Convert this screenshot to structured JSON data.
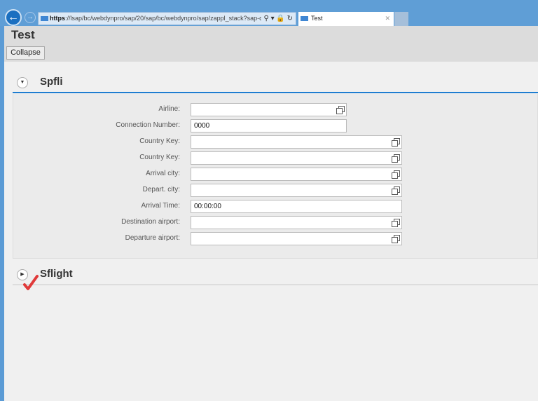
{
  "browser": {
    "url_scheme": "https",
    "url_rest": "://lsap/bc/webdynpro/sap/20/sap/bc/webdynpro/sap/zappl_stack?sap-client=",
    "tab_title": "Test",
    "accent": "#5f9ed6"
  },
  "header": {
    "title": "Test",
    "collapse_label": "Collapse"
  },
  "panels": [
    {
      "title": "Spfli",
      "expanded": true,
      "fields": [
        {
          "label": "Airline:",
          "value": "",
          "value_help": true
        },
        {
          "label": "Connection Number:",
          "value": "0000",
          "value_help": false
        },
        {
          "label": "Country Key:",
          "value": "",
          "value_help": true
        },
        {
          "label": "Country Key:",
          "value": "",
          "value_help": true
        },
        {
          "label": "Arrival city:",
          "value": "",
          "value_help": true
        },
        {
          "label": "Depart. city:",
          "value": "",
          "value_help": true
        },
        {
          "label": "Arrival Time:",
          "value": "00:00:00",
          "value_help": false
        },
        {
          "label": "Destination airport:",
          "value": "",
          "value_help": true
        },
        {
          "label": "Departure airport:",
          "value": "",
          "value_help": true
        }
      ]
    },
    {
      "title": "Sflight",
      "expanded": false
    }
  ]
}
